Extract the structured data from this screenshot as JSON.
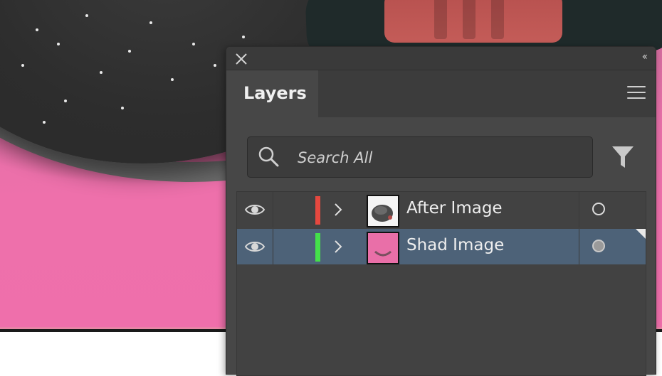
{
  "panel": {
    "title": "Layers",
    "search_placeholder": "Search All"
  },
  "layers": [
    {
      "name": "After Image",
      "color": "#e5483f",
      "visible": true,
      "selected": false
    },
    {
      "name": "Shad Image",
      "color": "#44e04a",
      "visible": true,
      "selected": true
    }
  ],
  "colors": {
    "panel_bg": "#474747",
    "selection": "#4d6278",
    "artboard_pink": "#ef6fab"
  },
  "icons": [
    "close-icon",
    "collapse-icon",
    "menu-icon",
    "search-icon",
    "filter-icon",
    "eye-icon",
    "chevron-right-icon"
  ]
}
